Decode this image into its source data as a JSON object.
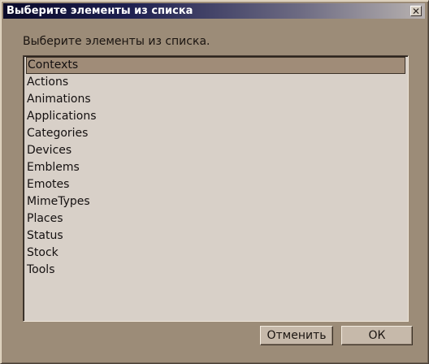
{
  "window": {
    "title": "Выберите элементы из списка",
    "close_glyph": "✕"
  },
  "prompt": "Выберите элементы из списка.",
  "list": {
    "items": [
      {
        "label": "Contexts",
        "selected": true
      },
      {
        "label": "Actions",
        "selected": false
      },
      {
        "label": "Animations",
        "selected": false
      },
      {
        "label": "Applications",
        "selected": false
      },
      {
        "label": "Categories",
        "selected": false
      },
      {
        "label": "Devices",
        "selected": false
      },
      {
        "label": "Emblems",
        "selected": false
      },
      {
        "label": "Emotes",
        "selected": false
      },
      {
        "label": "MimeTypes",
        "selected": false
      },
      {
        "label": "Places",
        "selected": false
      },
      {
        "label": "Status",
        "selected": false
      },
      {
        "label": "Stock",
        "selected": false
      },
      {
        "label": "Tools",
        "selected": false
      }
    ]
  },
  "buttons": {
    "cancel_label": "Отменить",
    "ok_label": "ОК"
  },
  "colors": {
    "window_bg": "#9c8c78",
    "list_bg": "#d8d0c8",
    "selection_bg": "#a08c78",
    "title_start": "#0a0a2a",
    "title_end": "#b8b2b0"
  }
}
